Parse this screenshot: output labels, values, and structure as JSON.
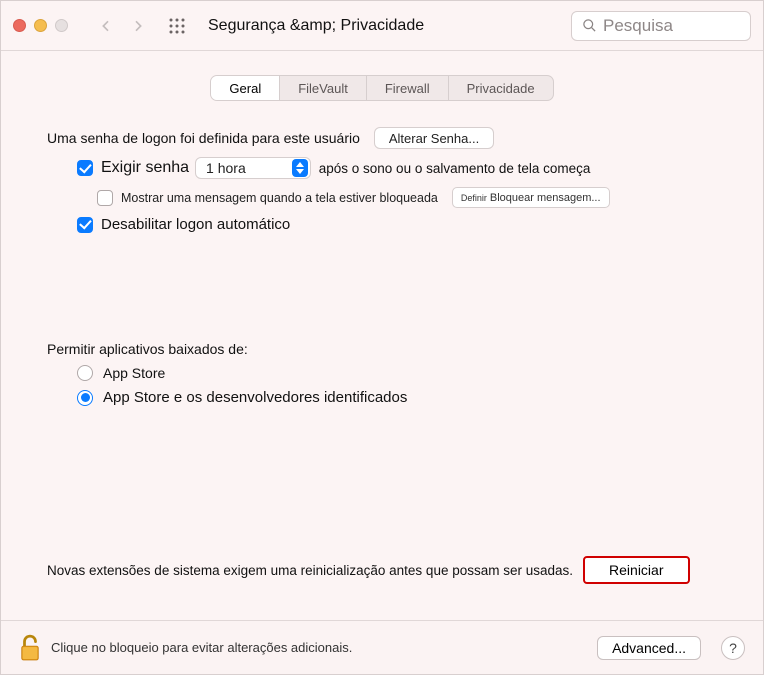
{
  "window": {
    "title": "Segurança &amp; Privacidade"
  },
  "search": {
    "placeholder": "Pesquisa"
  },
  "tabs": {
    "general": "Geral",
    "filevault": "FileVault",
    "firewall": "Firewall",
    "privacy": "Privacidade"
  },
  "login": {
    "password_set": "Uma senha de logon foi definida para este usuário",
    "change_password": "Alterar Senha...",
    "require_password_prefix": "Exigir senha",
    "require_password_delay": "1 hora",
    "require_password_suffix": "após o sono ou o salvamento de tela começa",
    "show_message": "Mostrar uma mensagem quando a tela estiver bloqueada",
    "set_lock_message_prefix": "Definir",
    "set_lock_message": "Bloquear mensagem...",
    "disable_auto_login": "Desabilitar logon automático"
  },
  "download": {
    "header": "Permitir aplicativos baixados de:",
    "appstore": "App Store",
    "identified": "App Store e os desenvolvedores identificados"
  },
  "extensions": {
    "message": "Novas extensões de sistema exigem uma reinicialização antes que possam ser usadas.",
    "restart": "Reiniciar"
  },
  "footer": {
    "lock_text": "Clique no bloqueio para evitar alterações adicionais.",
    "advanced": "Advanced...",
    "help": "?"
  }
}
